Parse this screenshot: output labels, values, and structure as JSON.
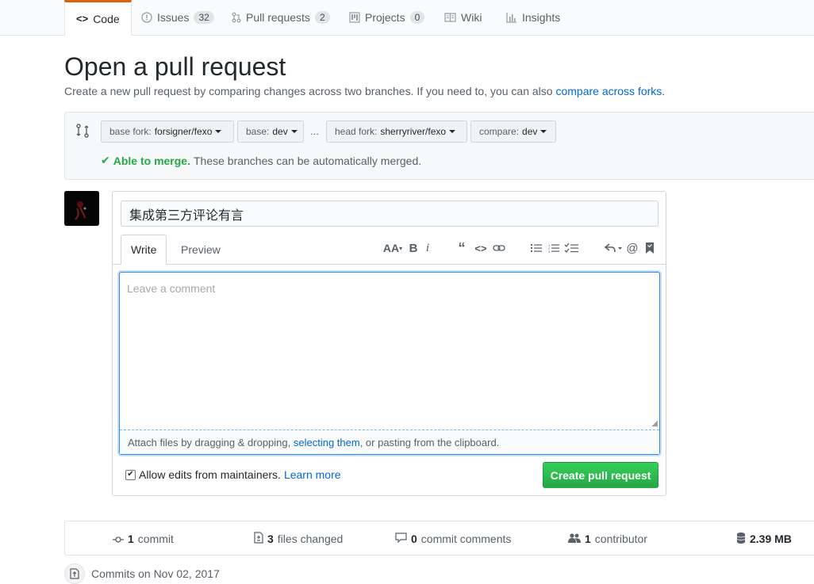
{
  "tabs": [
    {
      "label": "Code",
      "counter": null
    },
    {
      "label": "Issues",
      "counter": "32"
    },
    {
      "label": "Pull requests",
      "counter": "2"
    },
    {
      "label": "Projects",
      "counter": "0"
    },
    {
      "label": "Wiki",
      "counter": null
    },
    {
      "label": "Insights",
      "counter": null
    }
  ],
  "header": {
    "title": "Open a pull request",
    "subtitle": "Create a new pull request by comparing changes across two branches. If you need to, you can also",
    "subtitle_link": "compare across forks",
    "subtitle_end": "."
  },
  "compare": {
    "base_fork_label": "base fork:",
    "base_fork_value": "forsigner/fexo",
    "base_label": "base:",
    "base_value": "dev",
    "dots": "...",
    "head_fork_label": "head fork:",
    "head_fork_value": "sherryriver/fexo",
    "compare_label": "compare:",
    "compare_value": "dev",
    "merge_status": "Able to merge.",
    "merge_detail": "These branches can be automatically merged."
  },
  "form": {
    "title_value": "集成第三方评论有言",
    "write_tab": "Write",
    "preview_tab": "Preview",
    "comment_placeholder": "Leave a comment",
    "attach_text_1": "Attach files by dragging & dropping,",
    "attach_link": "selecting them",
    "attach_text_2": ", or pasting from the clipboard.",
    "allow_edits_label": "Allow edits from maintainers.",
    "learn_more": "Learn more",
    "submit_label": "Create pull request"
  },
  "stats": {
    "commits_count": "1",
    "commits_label": "commit",
    "files_count": "3",
    "files_label": "files changed",
    "comments_count": "0",
    "comments_label": "commit comments",
    "contributors_count": "1",
    "contributors_label": "contributor",
    "size": "2.39 MB"
  },
  "commits_header": "Commits on Nov 02, 2017",
  "colors": {
    "accent": "#0366d6",
    "success": "#28a745",
    "tab_highlight": "#e36209"
  }
}
